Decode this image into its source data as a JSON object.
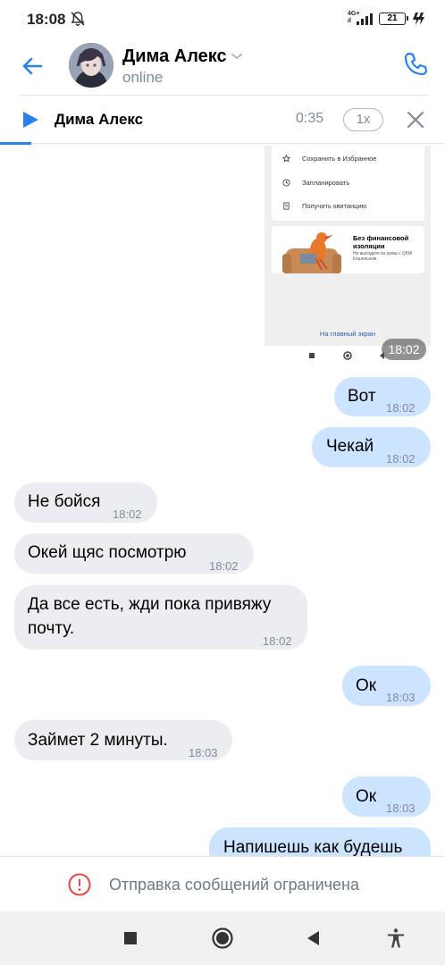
{
  "status_bar": {
    "time": "18:08",
    "network": "4G+",
    "network_sub": "ıl",
    "battery": "21",
    "icons": [
      "bell-off-icon",
      "signal-icon",
      "battery-icon",
      "charging-icon"
    ]
  },
  "header": {
    "contact_name": "Дима Алекс",
    "status": "online",
    "icons": [
      "back-arrow-icon",
      "chevron-down-icon",
      "phone-icon"
    ]
  },
  "player": {
    "title": "Дима Алекс",
    "time": "0:35",
    "speed": "1x",
    "progress": 0.07,
    "icons": [
      "play-icon",
      "close-icon"
    ]
  },
  "image_message": {
    "rows": [
      "Сохранить в Избранное",
      "Запланировать",
      "Получить квитанцию"
    ],
    "promo_title": "Без финансовой изоляции",
    "promo_subtitle": "Не выходите из дома с QIWI Кошельком",
    "link": "На главный экран",
    "time": "18:02"
  },
  "messages": [
    {
      "dir": "out",
      "text": "Вот",
      "time": "18:02"
    },
    {
      "dir": "out",
      "text": "Чекай",
      "time": "18:02"
    },
    {
      "dir": "in",
      "text": "Не бойся",
      "time": "18:02"
    },
    {
      "dir": "in",
      "text": "Окей щяс посмотрю",
      "time": "18:02"
    },
    {
      "dir": "in",
      "text_line1": "Да все есть, жди пока привяжу",
      "text_line2": "почту.",
      "time": "18:02"
    },
    {
      "dir": "out",
      "text": "Ок",
      "time": "18:03"
    },
    {
      "dir": "in",
      "text": "Займет 2 минуты.",
      "time": "18:03"
    },
    {
      "dir": "out",
      "text": "Ок",
      "time": "18:03"
    },
    {
      "dir": "out",
      "text": "Напишешь как будешь",
      "time": ""
    }
  ],
  "notice": {
    "text": "Отправка сообщений ограничена",
    "icon": "exclamation-circle-icon",
    "color": "#e64646"
  },
  "navbar": {
    "icons": [
      "recents-square-icon",
      "home-circle-icon",
      "back-triangle-icon",
      "accessibility-icon"
    ]
  },
  "colors": {
    "accent": "#2b82e6",
    "outgoing_bubble": "#cce4ff",
    "incoming_bubble": "#ebedf0",
    "secondary_text": "#818c99"
  }
}
